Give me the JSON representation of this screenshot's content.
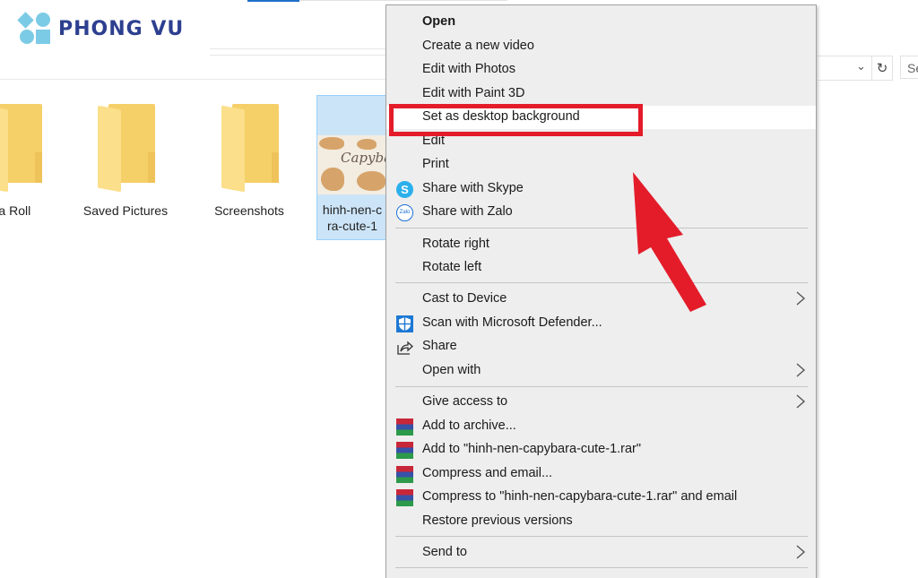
{
  "brand": {
    "logo_text": "PHONG VU",
    "logo_color": "#2d3f8f",
    "mark_color": "#7ccbe6"
  },
  "address_bar": {
    "refresh_icon": "refresh-icon",
    "chevron_icon": "chevron-down-icon",
    "search_placeholder": "Se"
  },
  "files": [
    {
      "name": "ra Roll",
      "type": "folder"
    },
    {
      "name": "Saved Pictures",
      "type": "folder"
    },
    {
      "name": "Screenshots",
      "type": "folder"
    },
    {
      "name": "hinh-nen-c ra-cute-1",
      "name_line1": "hinh-nen-c",
      "name_line2": "ra-cute-1",
      "type": "image",
      "selected": true,
      "thumb_text": "Capybara"
    }
  ],
  "context_menu": {
    "items": [
      {
        "label": "Open",
        "bold": true
      },
      {
        "label": "Create a new video"
      },
      {
        "label": "Edit with Photos"
      },
      {
        "label": "Edit with Paint 3D"
      },
      {
        "label": "Set as desktop background",
        "highlighted": true
      },
      {
        "label": "Edit"
      },
      {
        "label": "Print"
      },
      {
        "label": "Share with Skype",
        "icon": "skype-icon"
      },
      {
        "label": "Share with Zalo",
        "icon": "zalo-icon",
        "icon_text": "Zalo"
      },
      {
        "label": "Rotate right"
      },
      {
        "label": "Rotate left"
      },
      {
        "label": "Cast to Device",
        "submenu": true
      },
      {
        "label": "Scan with Microsoft Defender...",
        "icon": "defender-icon"
      },
      {
        "label": "Share",
        "icon": "share-icon"
      },
      {
        "label": "Open with",
        "submenu": true
      },
      {
        "label": "Give access to",
        "submenu": true
      },
      {
        "label": "Add to archive...",
        "icon": "winrar-icon"
      },
      {
        "label": "Add to \"hinh-nen-capybara-cute-1.rar\"",
        "icon": "winrar-icon"
      },
      {
        "label": "Compress and email...",
        "icon": "winrar-icon"
      },
      {
        "label": "Compress to \"hinh-nen-capybara-cute-1.rar\" and email",
        "icon": "winrar-icon"
      },
      {
        "label": "Restore previous versions"
      },
      {
        "label": "Send to",
        "submenu": true
      }
    ]
  },
  "annotation": {
    "highlight_color": "#e41c2a",
    "highlighted_item": "Set as desktop background"
  }
}
